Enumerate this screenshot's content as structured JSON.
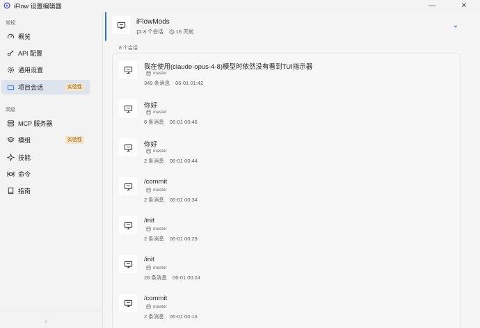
{
  "app": {
    "title": "iFlow 设置编辑器"
  },
  "window_controls": {
    "minimize": "—",
    "close": "✕"
  },
  "sidebar": {
    "sections": [
      {
        "label": "常规",
        "items": [
          {
            "label": "概览",
            "icon": "gauge-icon"
          },
          {
            "label": "API 配置",
            "icon": "key-icon"
          },
          {
            "label": "通用设置",
            "icon": "gear-icon"
          },
          {
            "label": "项目会话",
            "icon": "folder-icon",
            "badge": "实验性",
            "active": true
          }
        ]
      },
      {
        "label": "高级",
        "items": [
          {
            "label": "MCP 服务器",
            "icon": "server-icon"
          },
          {
            "label": "模组",
            "icon": "layers-icon",
            "badge": "实验性"
          },
          {
            "label": "技能",
            "icon": "sparkle-icon"
          },
          {
            "label": "命令",
            "icon": "command-icon"
          },
          {
            "label": "指南",
            "icon": "book-icon"
          }
        ]
      }
    ],
    "collapse": "‹"
  },
  "project": {
    "name": "iFlowMods",
    "sessions_meta": "8 个会话",
    "time_meta": "16 天前"
  },
  "sessions_count": "8 个会话",
  "sessions": [
    {
      "title": "我在使用(claude-opus-4-8)模型时依然没有看到TUI指示器",
      "branch": "master",
      "messages": "349 条消息",
      "time": "06-01 01:42"
    },
    {
      "title": "你好",
      "branch": "master",
      "messages": "6 条消息",
      "time": "06-01 00:46"
    },
    {
      "title": "你好",
      "branch": "master",
      "messages": "2 条消息",
      "time": "06-01 00:44"
    },
    {
      "title": "/commit",
      "branch": "master",
      "messages": "2 条消息",
      "time": "06-01 00:34"
    },
    {
      "title": "/init",
      "branch": "master",
      "messages": "2 条消息",
      "time": "06-01 00:29"
    },
    {
      "title": "/init",
      "branch": "master",
      "messages": "28 条消息",
      "time": "06-01 00:24"
    },
    {
      "title": "/commit",
      "branch": "master",
      "messages": "2 条消息",
      "time": "06-01 00:16"
    }
  ],
  "colors": {
    "accent": "#2f6ec7",
    "badge_bg": "#f7e4c4",
    "badge_text": "#8a5a12",
    "active_bg": "#dde4ee"
  }
}
